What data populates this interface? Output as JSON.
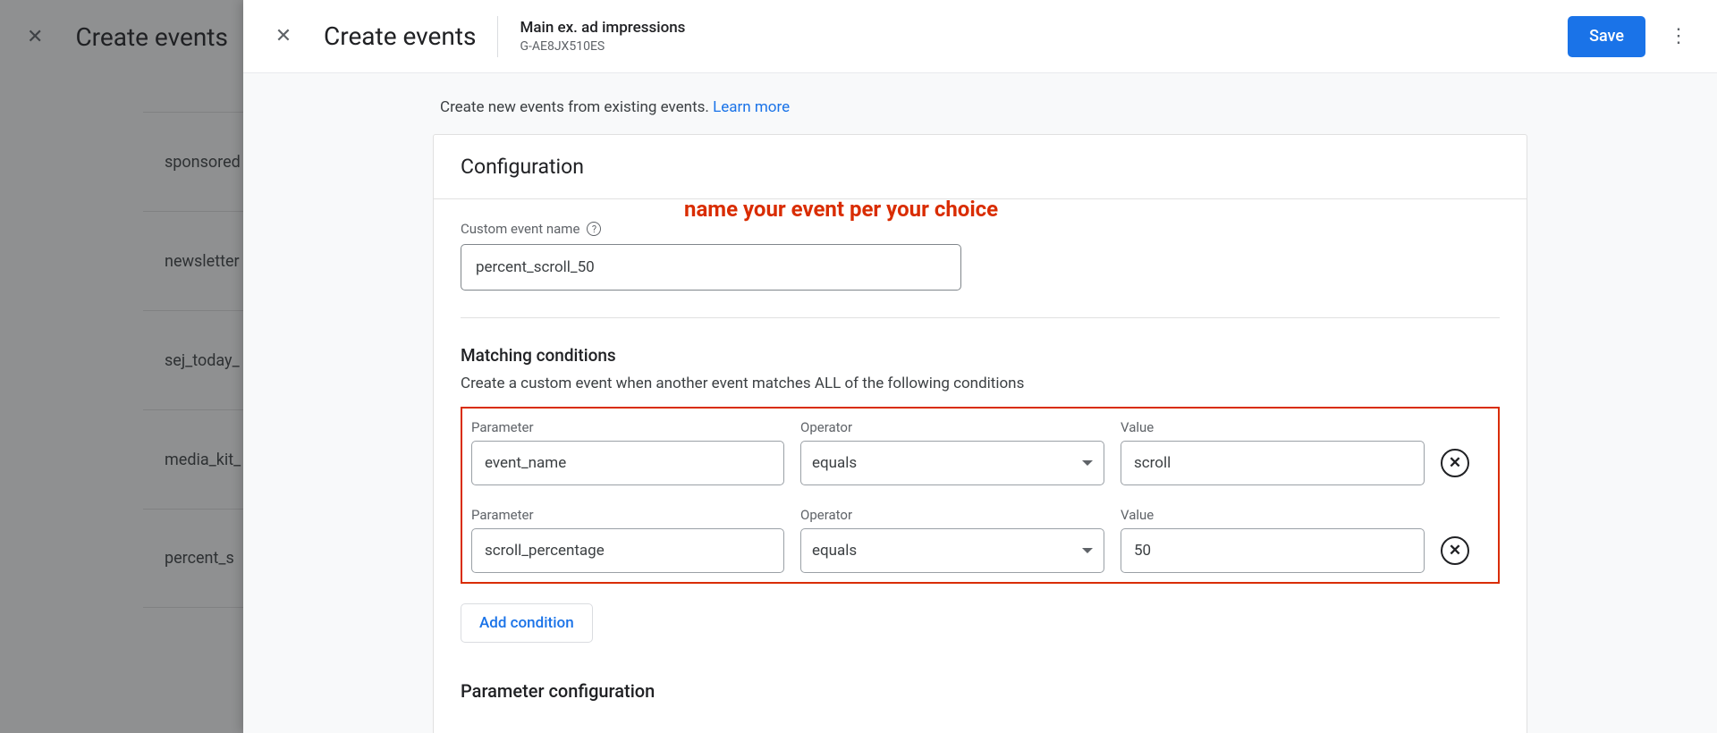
{
  "background": {
    "title": "Create events",
    "sidebar_items": [
      "sponsored",
      "newsletter",
      "sej_today_",
      "media_kit_",
      "percent_s"
    ]
  },
  "panel": {
    "title": "Create events",
    "property_name": "Main ex. ad impressions",
    "property_id": "G-AE8JX510ES",
    "save_label": "Save"
  },
  "intro": {
    "text": "Create new events from existing events. ",
    "link_label": "Learn more"
  },
  "card": {
    "header": "Configuration",
    "event_name_label": "Custom event name",
    "event_name_value": "percent_scroll_50",
    "annotation": "name your event per your choice",
    "matching_header": "Matching conditions",
    "matching_sub": "Create a custom event when another event matches ALL of the following conditions",
    "col_parameter": "Parameter",
    "col_operator": "Operator",
    "col_value": "Value",
    "conditions": [
      {
        "parameter": "event_name",
        "operator": "equals",
        "value": "scroll"
      },
      {
        "parameter": "scroll_percentage",
        "operator": "equals",
        "value": "50"
      }
    ],
    "add_condition_label": "Add condition",
    "param_config_header": "Parameter configuration"
  }
}
